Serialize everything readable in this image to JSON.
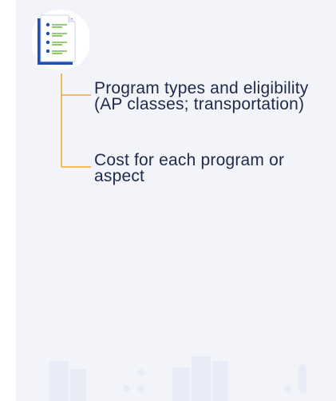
{
  "items": [
    {
      "text": "Program types and eligibility (AP classes; transportation)"
    },
    {
      "text": "Cost for each program or aspect"
    }
  ],
  "icons": {
    "document": "document-list-icon"
  },
  "colors": {
    "background": "#f2f4f9",
    "connector": "#f5a623",
    "text": "#1f2a4a",
    "icon_accent": "#1e4fb8",
    "icon_lines": "#6fbf4a"
  }
}
